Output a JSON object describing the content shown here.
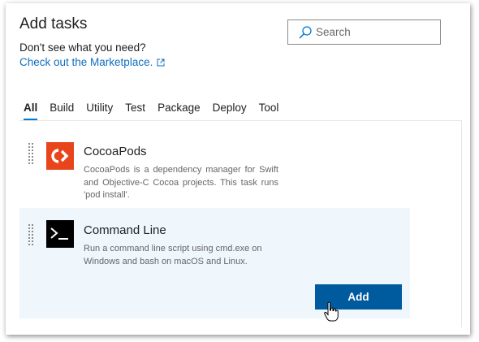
{
  "header": {
    "title": "Add tasks",
    "subtitle": "Don't see what you need?",
    "marketplace_link": "Check out the Marketplace."
  },
  "search": {
    "placeholder": "Search"
  },
  "tabs": [
    {
      "label": "All",
      "active": true
    },
    {
      "label": "Build"
    },
    {
      "label": "Utility"
    },
    {
      "label": "Test"
    },
    {
      "label": "Package"
    },
    {
      "label": "Deploy"
    },
    {
      "label": "Tool"
    }
  ],
  "tasks": [
    {
      "name": "CocoaPods",
      "description": "CocoaPods is a dependency manager for Swift and Objective-C Cocoa projects. This task runs 'pod install'.",
      "icon": "cocoapods-icon",
      "icon_color": "#e8451c"
    },
    {
      "name": "Command Line",
      "description": "Run a command line script using cmd.exe on Windows and bash on macOS and Linux.",
      "icon": "terminal-icon",
      "icon_color": "#000000",
      "selected": true,
      "add_label": "Add"
    }
  ],
  "colors": {
    "accent": "#0078d4",
    "link": "#106ebe",
    "add_button": "#005a9e",
    "selected_row": "#eff6fc"
  }
}
